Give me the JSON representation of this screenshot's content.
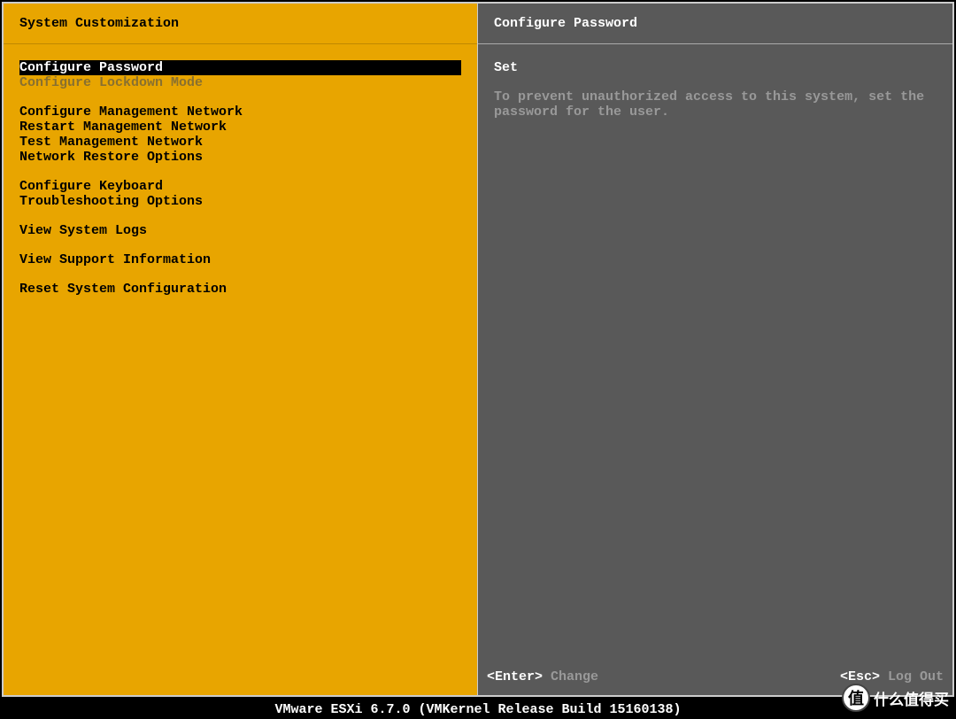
{
  "left": {
    "title": "System Customization",
    "groups": [
      [
        {
          "label": "Configure Password",
          "selected": true,
          "disabled": false
        },
        {
          "label": "Configure Lockdown Mode",
          "selected": false,
          "disabled": true
        }
      ],
      [
        {
          "label": "Configure Management Network",
          "selected": false,
          "disabled": false
        },
        {
          "label": "Restart Management Network",
          "selected": false,
          "disabled": false
        },
        {
          "label": "Test Management Network",
          "selected": false,
          "disabled": false
        },
        {
          "label": "Network Restore Options",
          "selected": false,
          "disabled": false
        }
      ],
      [
        {
          "label": "Configure Keyboard",
          "selected": false,
          "disabled": false
        },
        {
          "label": "Troubleshooting Options",
          "selected": false,
          "disabled": false
        }
      ],
      [
        {
          "label": "View System Logs",
          "selected": false,
          "disabled": false
        }
      ],
      [
        {
          "label": "View Support Information",
          "selected": false,
          "disabled": false
        }
      ],
      [
        {
          "label": "Reset System Configuration",
          "selected": false,
          "disabled": false
        }
      ]
    ]
  },
  "right": {
    "title": "Configure Password",
    "status": "Set",
    "description": "To prevent unauthorized access to this system, set the password for the user."
  },
  "hints": {
    "enter_key": "<Enter>",
    "enter_action": "Change",
    "esc_key": "<Esc>",
    "esc_action": "Log Out"
  },
  "bottom_bar": "VMware ESXi 6.7.0 (VMKernel Release Build 15160138)",
  "watermark": {
    "icon_text": "值",
    "text": "什么值得买"
  }
}
